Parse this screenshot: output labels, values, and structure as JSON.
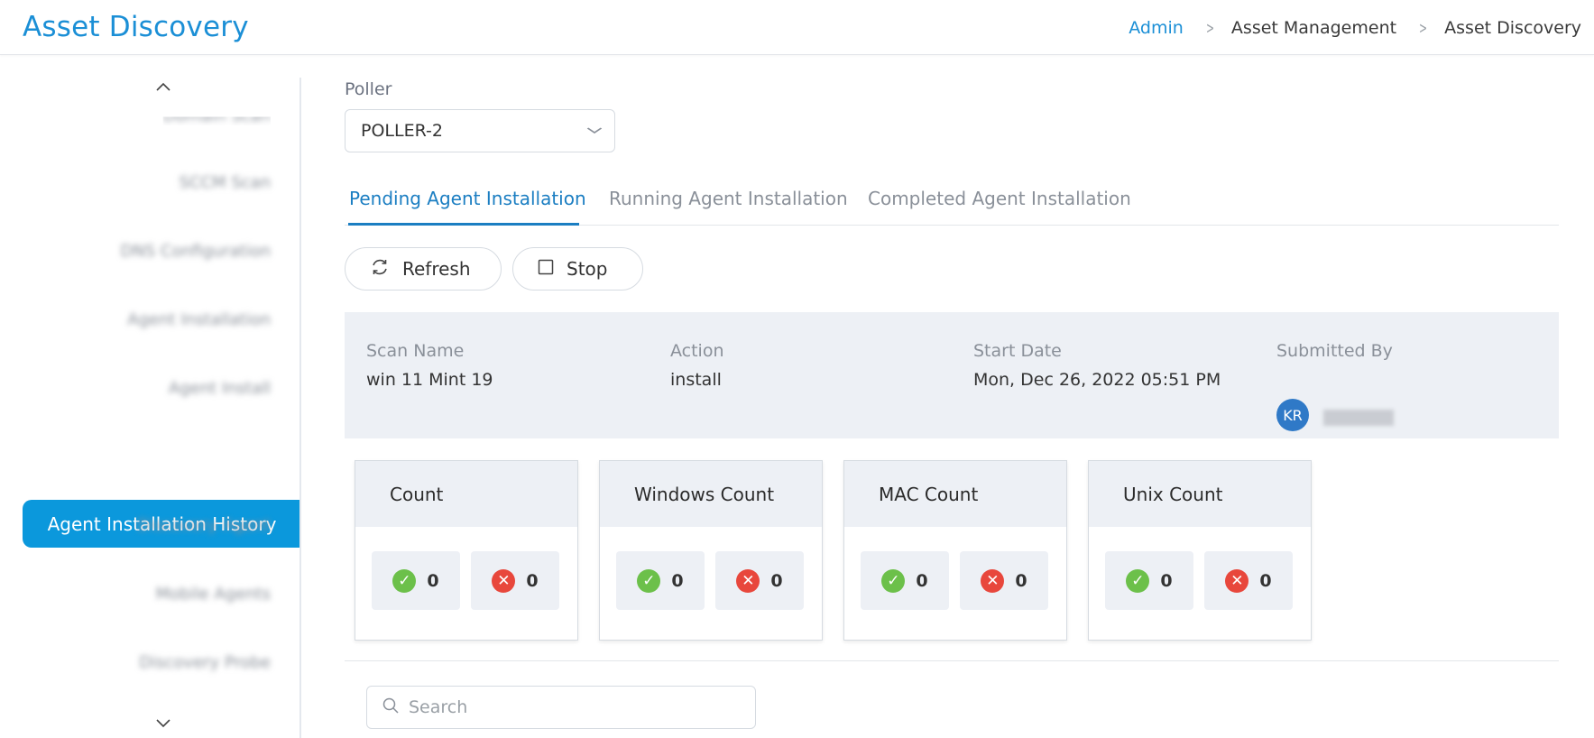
{
  "header": {
    "title": "Asset Discovery",
    "breadcrumb": [
      "Admin",
      "Asset Management",
      "Asset Discovery"
    ]
  },
  "sidebar": {
    "active_item": "Agent Installation History",
    "blurred_items": [
      "Domain Scan",
      "SCCM Scan",
      "DNS Configuration",
      "Agent Installation",
      "Agent Install",
      "Discovery Agent",
      "Mobile Agents",
      "Discovery Probe"
    ]
  },
  "poller": {
    "label": "Poller",
    "value": "POLLER-2"
  },
  "tabs": [
    "Pending Agent Installation",
    "Running Agent Installation",
    "Completed Agent Installation"
  ],
  "actions": {
    "refresh": "Refresh",
    "stop": "Stop"
  },
  "details": {
    "scan_name_label": "Scan Name",
    "scan_name": "win 11 Mint 19",
    "action_label": "Action",
    "action": "install",
    "start_date_label": "Start Date",
    "start_date": "Mon, Dec 26, 2022 05:51 PM",
    "submitted_by_label": "Submitted By",
    "avatar_initials": "KR"
  },
  "cards": [
    {
      "title": "Count",
      "success": "0",
      "failed": "0"
    },
    {
      "title": "Windows Count",
      "success": "0",
      "failed": "0"
    },
    {
      "title": "MAC Count",
      "success": "0",
      "failed": "0"
    },
    {
      "title": "Unix Count",
      "success": "0",
      "failed": "0"
    }
  ],
  "search": {
    "placeholder": "Search"
  },
  "colors": {
    "accent": "#1b8fd6",
    "active_nav": "#0b98dc",
    "success": "#6cc04a",
    "error": "#e8473c"
  }
}
